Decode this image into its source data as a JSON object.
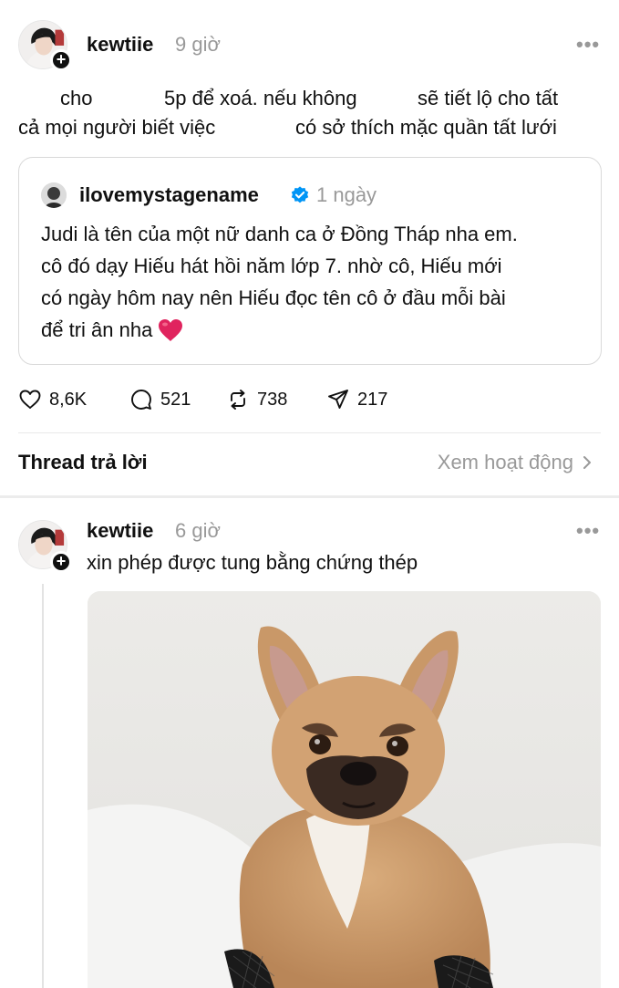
{
  "post": {
    "username": "kewtiie",
    "time": "9 giờ",
    "more_label": "•••",
    "text_line_1": [
      "cho",
      "5p để xoá. nếu không",
      "sẽ tiết lộ cho tất"
    ],
    "text_line_2": [
      "cả mọi người biết việc",
      "có sở thích mặc quần tất lưới"
    ]
  },
  "quote": {
    "username": "ilovemystagename",
    "verified": true,
    "time": "1 ngày",
    "lines": [
      "Judi là tên của một nữ danh ca ở Đồng Tháp nha em.",
      "cô đó dạy Hiếu hát hồi năm lớp 7. nhờ cô, Hiếu mới",
      "có ngày hôm nay nên Hiếu đọc tên cô ở đầu mỗi bài",
      "để tri ân nha"
    ]
  },
  "actions": {
    "likes": "8,6K",
    "replies": "521",
    "reposts": "738",
    "shares": "217"
  },
  "thread": {
    "heading": "Thread trả lời",
    "view_activity": "Xem hoạt động"
  },
  "reply": {
    "username": "kewtiie",
    "time": "6 giờ",
    "more_label": "•••",
    "text": "xin phép được tung bằng chứng thép"
  },
  "colors": {
    "text": "#101010",
    "muted": "#999999",
    "verified": "#0095f6",
    "heart": "#e0245e",
    "border": "#d9d9d9"
  }
}
